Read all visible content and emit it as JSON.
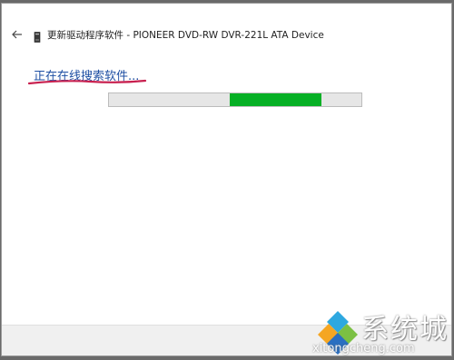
{
  "window": {
    "title": "更新驱动程序软件 - PIONEER DVD-RW  DVR-221L ATA Device"
  },
  "status": {
    "text": "正在在线搜索软件..."
  },
  "progress": {
    "indeterminate": true,
    "chunk_start_fraction": 0.48,
    "chunk_end_fraction": 0.84
  },
  "watermark": {
    "brand_text": "系统城",
    "url_text": "xitongcheng.com"
  },
  "colors": {
    "status_text": "#1e4fa3",
    "annotation_underline": "#c8204f",
    "progress_fill": "#06b025",
    "progress_track": "#e6e6e6"
  },
  "icons": {
    "back": "back-arrow-icon",
    "device": "dvd-drive-icon",
    "logo": "xitongcheng-logo-icon"
  }
}
